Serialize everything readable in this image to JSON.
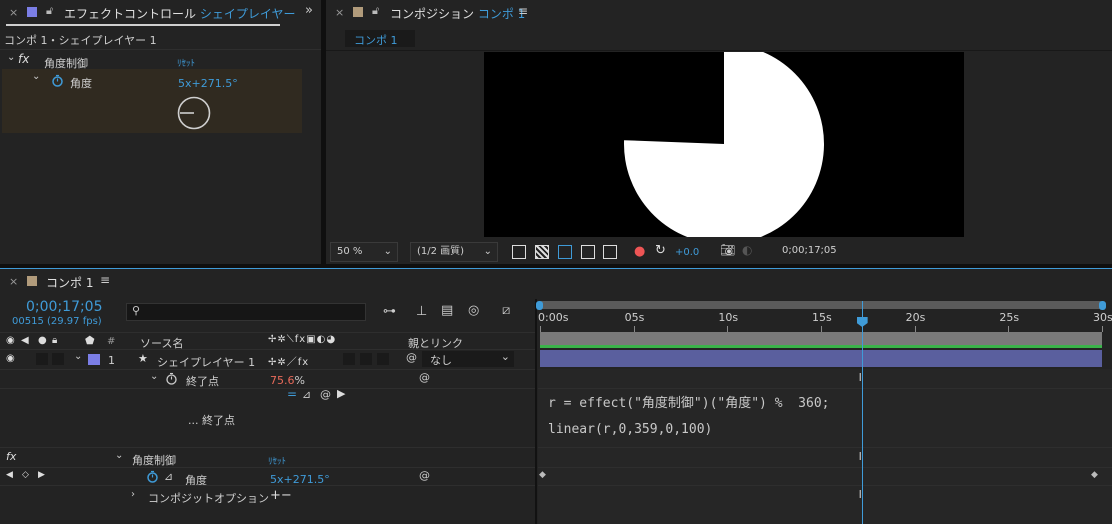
{
  "colors": {
    "accent": "#3f9bd8",
    "label_swatch": "#7b7ee6",
    "tan_swatch": "#b19b7b",
    "value_red": "#e86a5a",
    "layer_bar": "#5a5f9e",
    "green_bar": "#3bb34a"
  },
  "effect_panel": {
    "tab_prefix": "エフェクトコントロール",
    "tab_layer": "シェイプレイヤー 1",
    "breadcrumb": "コンポ 1・シェイプレイヤー 1",
    "effect_name": "角度制御",
    "reset": "ﾘｾｯﾄ",
    "prop_name": "角度",
    "prop_value": "5x+271.5°"
  },
  "comp_panel": {
    "tab_prefix": "コンポジション",
    "tab_comp": "コンポ 1",
    "subtab": "コンポ 1",
    "zoom": "50 %",
    "resolution": "(1/2 画質)",
    "exposure": "+0.0",
    "timecode": "0;00;17;05",
    "pie_fill_percent": 75.6
  },
  "timeline": {
    "tab": "コンポ 1",
    "timecode": "0;00;17;05",
    "frames": "00515 (29.97 fps)",
    "search_placeholder": "",
    "col_hash": "#",
    "col_source": "ソース名",
    "col_parent": "親とリンク",
    "ruler": [
      "0:00s",
      "05s",
      "10s",
      "15s",
      "20s",
      "25s",
      "30s"
    ],
    "layer_index": "1",
    "layer_name": "シェイプレイヤー 1",
    "parent_value": "なし",
    "trim_end_label": "終了点",
    "trim_end_value": "75.6",
    "trim_end_unit": "%",
    "expr_label": "... 終了点",
    "expr_line1": "r = effect(\"角度制御\")(\"角度\") %  360;",
    "expr_line2": "linear(r,0,359,0,100)",
    "effect_name": "角度制御",
    "reset": "ﾘｾｯﾄ",
    "angle_label": "角度",
    "angle_value": "5x+271.5°",
    "composite_label": "コンポジットオプション",
    "composite_ops": "+−",
    "playhead_seconds": 17.17,
    "duration_seconds": 30
  }
}
